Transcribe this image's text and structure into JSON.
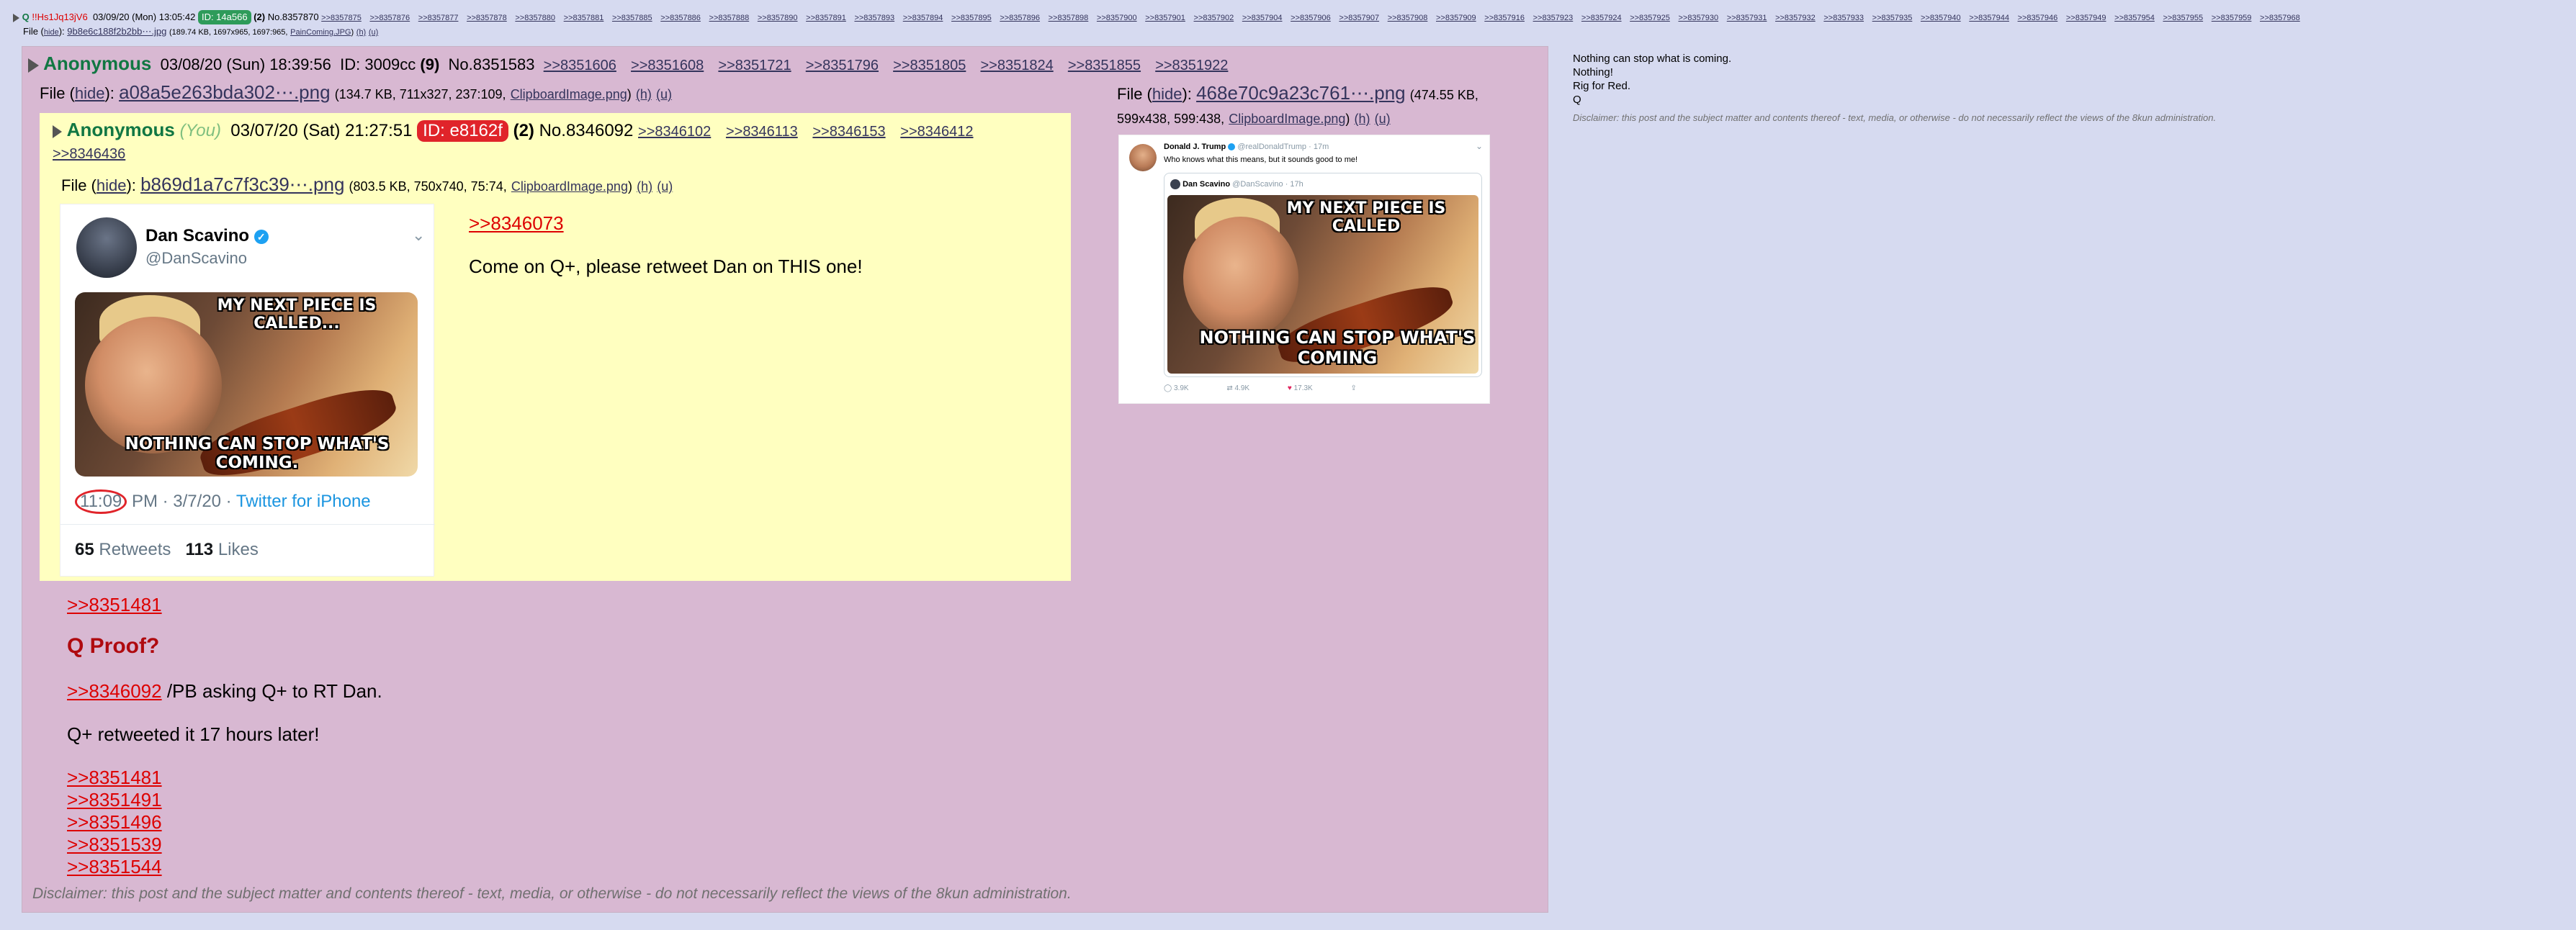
{
  "top_post": {
    "name": "Q",
    "trip": "!!Hs1Jq13jV6",
    "date": "03/09/20 (Mon) 13:05:42",
    "id_label": "ID: 14a566",
    "id_color": "#2e9b5a",
    "count": "(2)",
    "post_no": "No.8357870",
    "backlinks": [
      ">>8357875",
      ">>8357876",
      ">>8357877",
      ">>8357878",
      ">>8357880",
      ">>8357881",
      ">>8357885",
      ">>8357886",
      ">>8357888",
      ">>8357890",
      ">>8357891",
      ">>8357893",
      ">>8357894",
      ">>8357895",
      ">>8357896",
      ">>8357898",
      ">>8357900",
      ">>8357901",
      ">>8357902",
      ">>8357904",
      ">>8357906",
      ">>8357907",
      ">>8357908",
      ">>8357909",
      ">>8357916",
      ">>8357923",
      ">>8357924",
      ">>8357925",
      ">>8357930",
      ">>8357931",
      ">>8357932",
      ">>8357933",
      ">>8357935",
      ">>8357940",
      ">>8357944",
      ">>8357946",
      ">>8357949",
      ">>8357954",
      ">>8357955",
      ">>8357959",
      ">>8357968"
    ],
    "file_label": "File (",
    "hide_label": "hide",
    "file_close": "):",
    "file_name": "9b8e6c188f2b2bb⋯.jpg",
    "file_meta": "(189.74 KB, 1697x965, 1697:965,",
    "file_orig": "PainComing.JPG",
    "file_meta_end": ")",
    "h_link": "(h)",
    "u_link": "(u)"
  },
  "right_column": {
    "lines": [
      "Nothing can stop what is coming.",
      "Nothing!",
      "Rig for Red.",
      "Q"
    ],
    "disclaimer": "Disclaimer: this post and the subject matter and contents thereof - text, media, or otherwise - do not necessarily reflect the views of the 8kun administration."
  },
  "main_post": {
    "name": "Anonymous",
    "date": "03/08/20 (Sun) 18:39:56",
    "id_text": "ID: 3009cc",
    "count": "(9)",
    "post_no": "No.8351583",
    "backlinks": [
      ">>8351606",
      ">>8351608",
      ">>8351721",
      ">>8351796",
      ">>8351805",
      ">>8351824",
      ">>8351855",
      ">>8351922"
    ],
    "file_label": "File (",
    "hide_label": "hide",
    "file_close": "):",
    "file_name": "a08a5e263bda302⋯.png",
    "file_meta": "(134.7 KB, 711x327, 237:109,",
    "file_orig": "ClipboardImage.png",
    "file_meta_end": ")",
    "h_link": "(h)",
    "u_link": "(u)",
    "file2_label": "File (",
    "file2_name": "468e70c9a23c761⋯.png",
    "file2_meta": "(474.55 KB,",
    "file2_meta2": "599x438, 599:438,",
    "file2_orig": "ClipboardImage.png",
    "file2_meta_end": ")",
    "body": {
      "link1": ">>8351481",
      "heading": "Q Proof?",
      "link2": ">>8346092",
      "line2_text": " /PB asking Q+ to RT Dan.",
      "line3": "Q+ retweeted it 17 hours later!",
      "links": [
        ">>8351481",
        ">>8351491",
        ">>8351496",
        ">>8351539",
        ">>8351544"
      ]
    },
    "disclaimer": "Disclaimer: this post and the subject matter and contents thereof - text, media, or otherwise - do not necessarily reflect the views of the 8kun administration."
  },
  "quoted_post": {
    "name": "Anonymous",
    "you": "(You)",
    "date": "03/07/20 (Sat) 21:27:51",
    "id_label": "ID: e8162f",
    "id_color": "#e0242a",
    "count": "(2)",
    "post_no": "No.8346092",
    "backlinks": [
      ">>8346102",
      ">>8346113",
      ">>8346153",
      ">>8346412",
      ">>8346436"
    ],
    "file_label": "File (",
    "hide_label": "hide",
    "file_close": "):",
    "file_name": "b869d1a7c7f3c39⋯.png",
    "file_meta": "(803.5 KB, 750x740, 75:74,",
    "file_orig": "ClipboardImage.png",
    "file_meta_end": ")",
    "h_link": "(h)",
    "u_link": "(u)",
    "quote_link": ">>8346073",
    "message": "Come on Q+, please retweet Dan on THIS one!"
  },
  "tweet_scavino": {
    "display_name": "Dan Scavino",
    "handle": "@DanScavino",
    "meme_top": "MY NEXT PIECE IS CALLED...",
    "meme_bottom": "NOTHING CAN STOP WHAT'S COMING.",
    "time": "11:09",
    "time_rest": "PM · 3/7/20 ·",
    "source": "Twitter for iPhone",
    "retweets_num": "65",
    "retweets_label": "Retweets",
    "likes_num": "113",
    "likes_label": "Likes"
  },
  "tweet_trump": {
    "display_name": "Donald J. Trump",
    "handle": "@realDonaldTrump · 17m",
    "text": "Who knows what this means, but it sounds good to me!",
    "inner_name": "Dan Scavino",
    "inner_handle": "@DanScavino · 17h",
    "meme_top": "MY NEXT PIECE IS CALLED",
    "meme_bottom": "NOTHING CAN STOP WHAT'S COMING",
    "replies": "3.9K",
    "retweets": "4.9K",
    "likes": "17.3K",
    "like_color": "#e0245e"
  }
}
